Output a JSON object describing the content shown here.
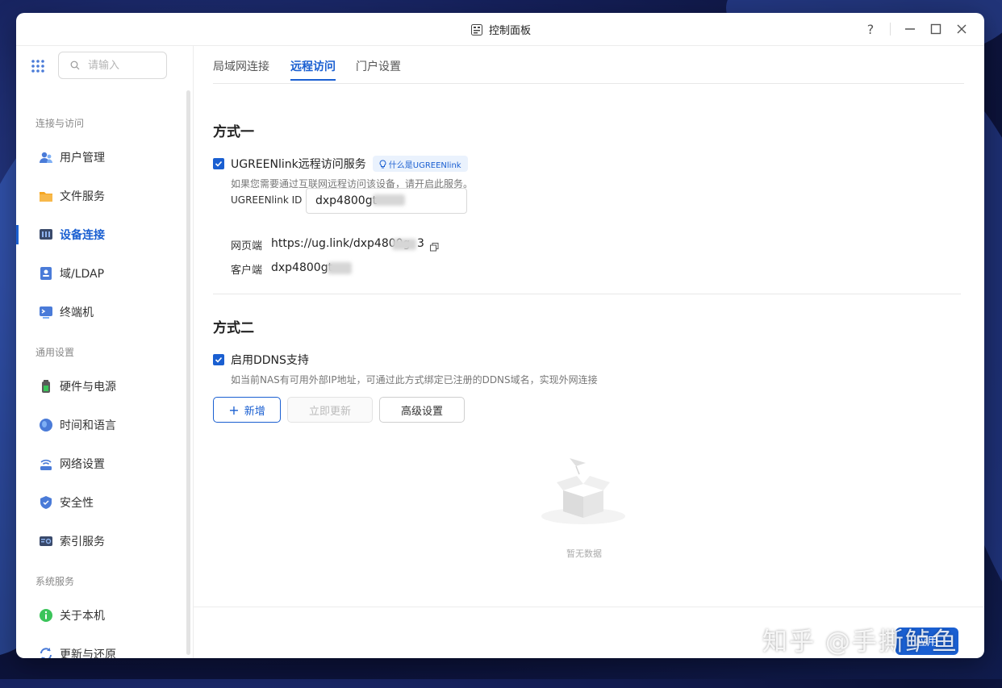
{
  "window": {
    "title": "控制面板"
  },
  "controls": {
    "help": "?",
    "minimize": "—",
    "maximize": "☐",
    "close": "✕"
  },
  "search": {
    "placeholder": "请输入"
  },
  "sidebar": {
    "sections": [
      "连接与访问",
      "通用设置",
      "系统服务"
    ],
    "items": [
      {
        "label": "用户管理",
        "icon": "users-icon"
      },
      {
        "label": "文件服务",
        "icon": "folder-icon"
      },
      {
        "label": "设备连接",
        "icon": "device-icon",
        "active": true
      },
      {
        "label": "域/LDAP",
        "icon": "ldap-icon"
      },
      {
        "label": "终端机",
        "icon": "terminal-icon"
      },
      {
        "label": "硬件与电源",
        "icon": "battery-icon"
      },
      {
        "label": "时间和语言",
        "icon": "globe-icon"
      },
      {
        "label": "网络设置",
        "icon": "network-icon"
      },
      {
        "label": "安全性",
        "icon": "shield-icon"
      },
      {
        "label": "索引服务",
        "icon": "index-icon"
      },
      {
        "label": "关于本机",
        "icon": "info-icon"
      },
      {
        "label": "更新与还原",
        "icon": "refresh-icon"
      }
    ]
  },
  "tabs": [
    "局域网连接",
    "远程访问",
    "门户设置"
  ],
  "method1": {
    "title": "方式一",
    "checkbox_label": "UGREENlink远程访问服务",
    "help_chip": "什么是UGREENlink",
    "hint": "如果您需要通过互联网远程访问该设备，请开启此服务。",
    "id_label": "UGREENlink ID",
    "id_value": "dxp4800gt-",
    "web_label": "网页端",
    "web_value": "https://ug.link/dxp4800g",
    "web_tail": "3",
    "client_label": "客户端",
    "client_value": "dxp4800gt-"
  },
  "method2": {
    "title": "方式二",
    "checkbox_label": "启用DDNS支持",
    "hint": "如当前NAS有可用外部IP地址，可通过此方式绑定已注册的DDNS域名，实现外网连接",
    "add_button": "新增",
    "update_button": "立即更新",
    "advanced_button": "高级设置",
    "empty_text": "暂无数据"
  },
  "footer": {
    "apply_button": "应用"
  },
  "watermark": "知乎 @手撕鲈鱼",
  "colors": {
    "accent": "#1a5fd1"
  }
}
